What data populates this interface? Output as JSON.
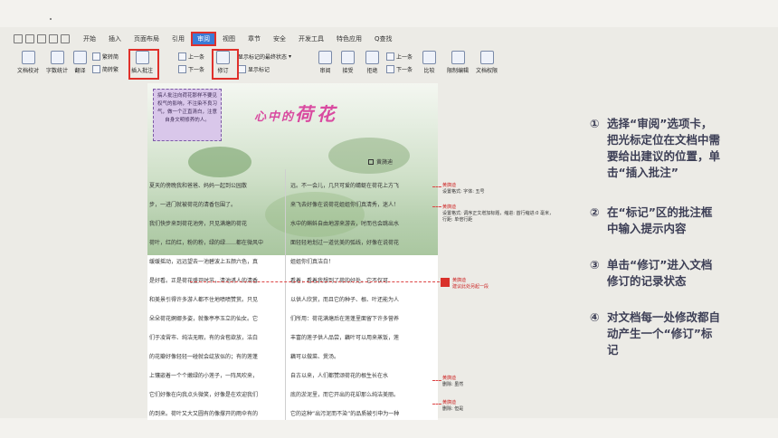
{
  "ribbon": {
    "tabs": [
      "开始",
      "插入",
      "页面布局",
      "引用",
      "审阅",
      "视图",
      "章节",
      "安全",
      "开发工具",
      "特色应用",
      "Q查找"
    ],
    "buttons": {
      "doc_proofread": "文档校对",
      "word_count": "字数统计",
      "translate": "翻译",
      "to_traditional": "繁转简",
      "to_simplified": "简转繁",
      "insert_comment": "插入批注",
      "prev": "上一条",
      "next": "下一条",
      "track_changes": "修订",
      "show_markup_final": "显示标记的最终状态",
      "show_markup": "显示标记",
      "review_pane": "审阅",
      "accept": "接受",
      "reject": "拒绝",
      "prev2": "上一条",
      "next2": "下一条",
      "compare": "比较",
      "restrict_editing": "限制编辑",
      "doc_rights": "文档权限"
    }
  },
  "document": {
    "note": "搞人批注向荷花那样不要见权气的影响，不注染不良习气，做一个正直清白，注意自身文明修养的人。",
    "title_prefix": "心中的",
    "title_main": "荷花",
    "author": "黄旖迪",
    "left_lines": [
      "夏天的傍晚我和爸爸、妈妈一起到公园散",
      "步，一进门就被荷花的清香包围了。",
      "我们快步来到荷花池旁，只见满塘的荷花",
      "荷叶，红的红，粉的粉，绿的绿……都在微风中",
      "缓缓摇动，远远望去一池碧波上五颜六色，真",
      "是好看。正是荷花盛开时节，清池诱人的清香",
      "和美景引得许多游人都不住地啧啧赞赏。只见",
      "朵朵荷花婀娜多姿，就像亭亭玉立的仙女。它",
      "们于凌霄市、纯洁无暇，有的含苞欲放，洁白",
      "的花瓣好像轻轻一碰就会绽放似的；有的莲蓬",
      "上镶嵌着一个个嫩绿的小莲子，一阵风吹来，",
      "它们好像在向我点头微笑，好像是在欢迎我们",
      "的到来。荷叶又大又圆有的像撑开的雨伞有的"
    ],
    "right_lines": [
      "远。不一会儿，几只可爱的蜻蜓在荷花上方飞",
      "来飞去好像在说荷花姐姐你们真清秀，迷人！",
      "水中的蝌蚪自由地游来游去，时而也会跳出水",
      "面轻轻地划过一道优美的弧线，好像在说荷花",
      "姐姐你们真洁白！",
      "看着，看着我想到了荷的好处。它不仅可",
      "以供人欣赏，而且它的种子、根、叶还能为人",
      "们所用：荷花满塘后在莲蓬里面留下许多营养",
      "丰富的莲子供人品尝，藕叶可以用来蒸饭，莲",
      "藕可以做菜、煲汤。",
      "自古以来，人们都赞颂荷花的根生长在水",
      "底的淤泥里，而它开出的花却那么纯洁美丽。",
      "它的这种“出污泥而不染”的品质被引申为一种"
    ],
    "comments": [
      {
        "author": "黄旖迪",
        "text": "设置格式: 字体: 五号"
      },
      {
        "author": "黄旖迪",
        "text": "设置格式: 调序正文增加标题，缩进: 首行缩进:0 毫米，"
      },
      {
        "author": "",
        "text": "行距: 单倍行距"
      },
      {
        "author": "黄旖迪",
        "text": "建议此处另起一段"
      },
      {
        "author": "黄旖迪",
        "text": "删除: 虽然"
      },
      {
        "author": "黄旖迪",
        "text": "删除: 但是"
      }
    ]
  },
  "steps": [
    {
      "num": "①",
      "text": "选择“审阅”选项卡，\n把光标定位在文档中需\n要给出建议的位置，单\n击“插入批注”"
    },
    {
      "num": "②",
      "text": "在“标记”区的批注框\n中输入提示内容"
    },
    {
      "num": "③",
      "text": "单击“修订”进入文档\n修订的记录状态"
    },
    {
      "num": "④",
      "text": "对文档每一处修改都自\n动产生一个“修订”标\n记"
    }
  ]
}
